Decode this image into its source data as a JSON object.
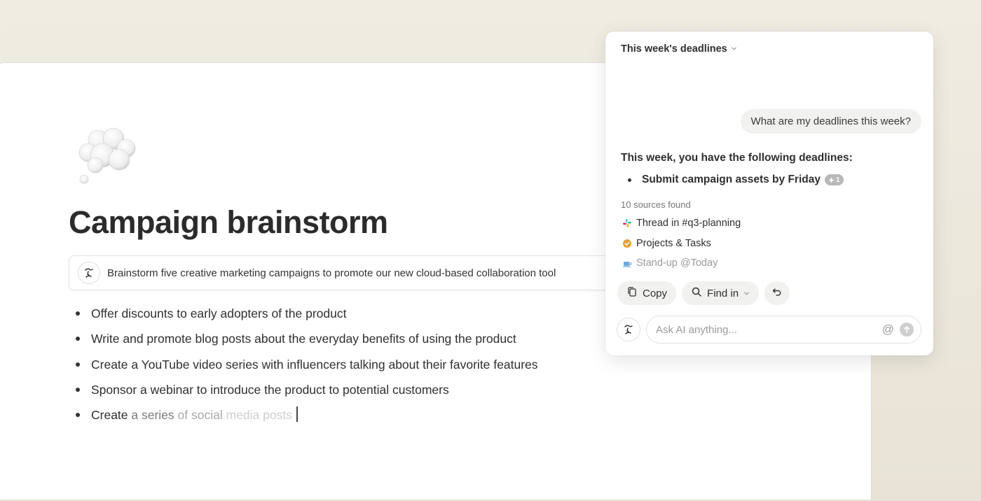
{
  "document": {
    "title": "Campaign brainstorm",
    "icon": "thought-bubble-cloud",
    "prompt": "Brainstorm five creative marketing campaigns to promote our new cloud-based collaboration tool",
    "bullets": [
      "Offer discounts to early adopters of the product",
      "Write and promote blog posts about the everyday benefits of using the product",
      "Create a YouTube video series with influencers talking about their favorite features",
      "Sponsor a webinar to introduce the product to potential customers"
    ],
    "streaming_bullet": {
      "part1": "Create",
      "part2": " a series",
      "part3": " of social",
      "part4": " media posts"
    }
  },
  "ai_panel": {
    "header": "This week's deadlines",
    "user_message": "What are my deadlines this week?",
    "answer_intro": "This week, you have the following deadlines:",
    "answer_items": [
      "Submit campaign assets by Friday"
    ],
    "citation_count": "1",
    "sources_label": "10 sources found",
    "sources": [
      {
        "label": "Thread in #q3-planning",
        "icon": "slack-icon"
      },
      {
        "label": "Projects & Tasks",
        "icon": "check-badge-icon"
      },
      {
        "label": "Stand-up @Today",
        "icon": "coffee-icon"
      }
    ],
    "actions": {
      "copy": "Copy",
      "find_in": "Find in"
    },
    "input_placeholder": "Ask AI anything...",
    "at_symbol": "@"
  },
  "colors": {
    "background": "#ece8dc",
    "page": "#ffffff",
    "bubble": "#f1f1ef",
    "text": "#2f2f2f"
  }
}
